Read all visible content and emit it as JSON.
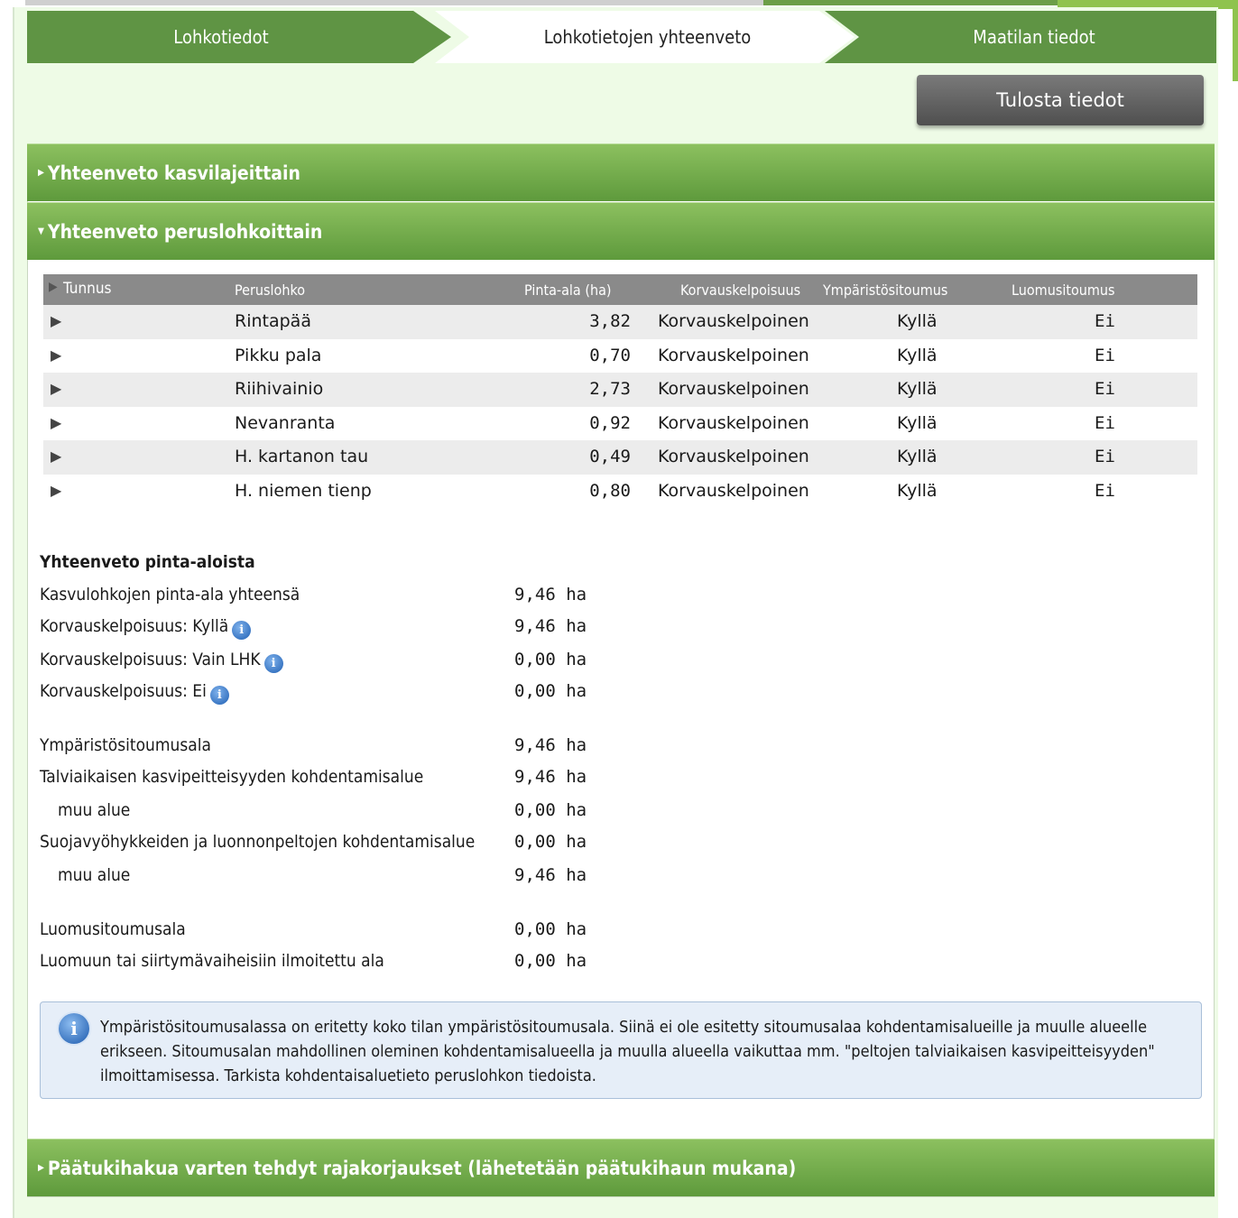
{
  "steps": [
    {
      "label": "Lohkotiedot"
    },
    {
      "label": "Lohkotietojen yhteenveto"
    },
    {
      "label": "Maatilan tiedot"
    }
  ],
  "print_button": "Tulosta tiedot",
  "accordions": {
    "by_crop": "Yhteenveto kasvilajeittain",
    "by_parcel": "Yhteenveto peruslohkoittain",
    "corrections": "Päätukihakua varten tehdyt rajakorjaukset (lähetetään päätukihaun mukana)"
  },
  "table": {
    "headers": {
      "tunnus": "Tunnus",
      "peruslohko": "Peruslohko",
      "pinta_ala": "Pinta-ala (ha)",
      "korvauskelpoisuus": "Korvauskelpoisuus",
      "ymparistositoumus": "Ympäristösitoumus",
      "luomusitoumus": "Luomusitoumus"
    },
    "rows": [
      {
        "name": "Rintapää",
        "area": "3,82",
        "korv": "Korvauskelpoinen",
        "ymp": "Kyllä",
        "luomu": "Ei"
      },
      {
        "name": "Pikku pala",
        "area": "0,70",
        "korv": "Korvauskelpoinen",
        "ymp": "Kyllä",
        "luomu": "Ei"
      },
      {
        "name": "Riihivainio",
        "area": "2,73",
        "korv": "Korvauskelpoinen",
        "ymp": "Kyllä",
        "luomu": "Ei"
      },
      {
        "name": "Nevanranta",
        "area": "0,92",
        "korv": "Korvauskelpoinen",
        "ymp": "Kyllä",
        "luomu": "Ei"
      },
      {
        "name": "H. kartanon tau",
        "area": "0,49",
        "korv": "Korvauskelpoinen",
        "ymp": "Kyllä",
        "luomu": "Ei"
      },
      {
        "name": "H. niemen tienp",
        "area": "0,80",
        "korv": "Korvauskelpoinen",
        "ymp": "Kyllä",
        "luomu": "Ei"
      }
    ]
  },
  "summary": {
    "title": "Yhteenveto pinta-aloista",
    "lines": [
      {
        "label": "Kasvulohkojen pinta-ala yhteensä",
        "value": "9,46 ha"
      },
      {
        "label": "Korvauskelpoisuus: Kyllä",
        "value": "9,46 ha"
      },
      {
        "label": "Korvauskelpoisuus: Vain LHK",
        "value": "0,00 ha"
      },
      {
        "label": "Korvauskelpoisuus: Ei",
        "value": "0,00 ha"
      },
      {
        "label": "Ympäristösitoumusala",
        "value": "9,46 ha"
      },
      {
        "label": "Talviaikaisen kasvipeitteisyyden kohdentamisalue",
        "value": "9,46 ha"
      },
      {
        "label": "muu alue",
        "value": "0,00 ha"
      },
      {
        "label": "Suojavyöhykkeiden ja luonnonpeltojen kohdentamisalue",
        "value": "0,00 ha"
      },
      {
        "label": "muu alue",
        "value": "9,46 ha"
      },
      {
        "label": "Luomusitoumusala",
        "value": "0,00 ha"
      },
      {
        "label": "Luomuun tai siirtymävaiheisiin ilmoitettu ala",
        "value": "0,00 ha"
      }
    ]
  },
  "info_note": "Ympäristösitoumusalassa on eritetty koko tilan ympäristösitoumusala. Siinä ei ole esitetty sitoumusalaa kohdentamisalueille ja muulle alueelle erikseen. Sitoumusalan mahdollinen oleminen kohdentamisalueella ja muulla alueella vaikuttaa mm. \"peltojen talviaikaisen kasvipeitteisyyden\" ilmoittamisessa. Tarkista kohdentaisaluetieto peruslohkon tiedoista.",
  "colors": {
    "tab_green": "#5f9444",
    "header_green": "#6fa84a",
    "table_header_grey": "#8a8a8a",
    "info_blue": "#1f5fb3"
  }
}
